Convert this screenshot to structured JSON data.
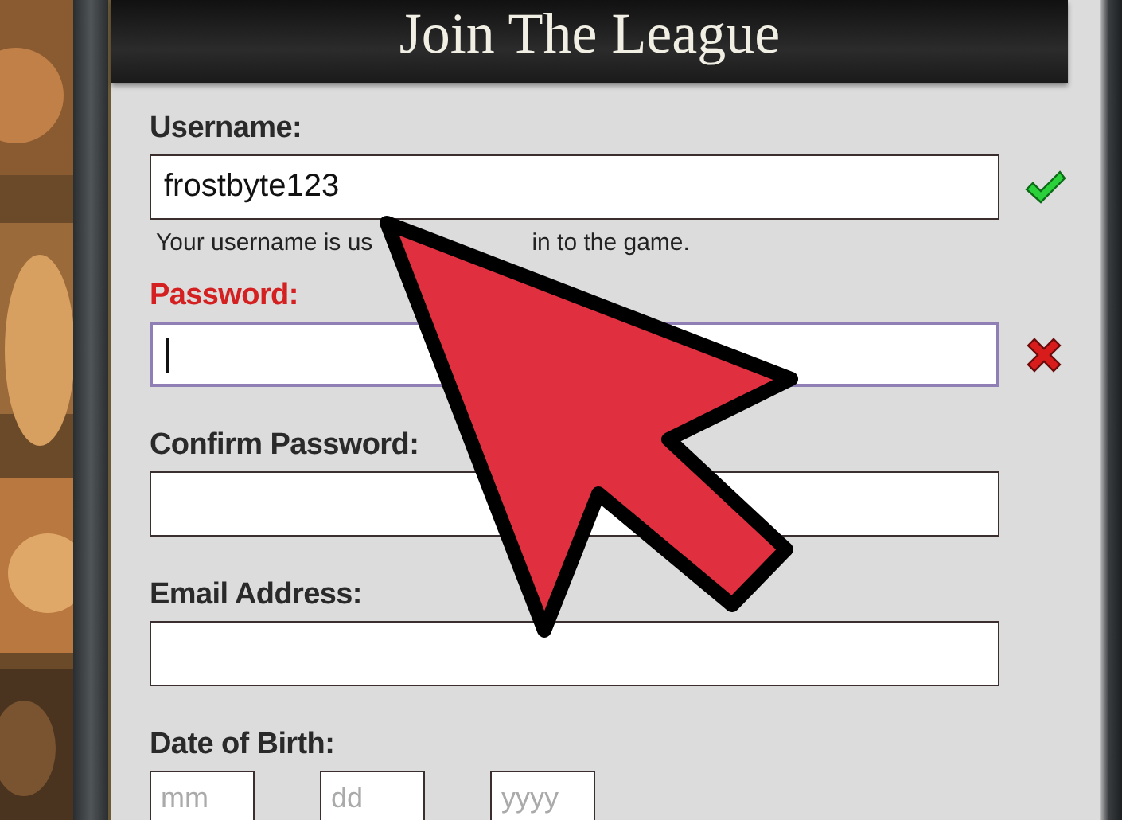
{
  "header": {
    "title": "Join The League"
  },
  "fields": [
    {
      "kind": "text",
      "label": "Username:",
      "value": "frostbyte123",
      "valid": true,
      "focused": false,
      "hints": [
        "Your username is us",
        "in to the game."
      ]
    },
    {
      "kind": "text",
      "label": "Password:",
      "valid": false,
      "focused": true
    },
    {
      "kind": "text",
      "label": "Confirm Password:",
      "focused": false
    },
    {
      "kind": "text",
      "label": "Email Address:",
      "focused": false
    },
    {
      "kind": "date",
      "label": "Date of Birth:",
      "parts": [
        {
          "placeholder": "mm"
        },
        {
          "placeholder": "dd"
        },
        {
          "placeholder": "yyyy"
        }
      ]
    }
  ]
}
